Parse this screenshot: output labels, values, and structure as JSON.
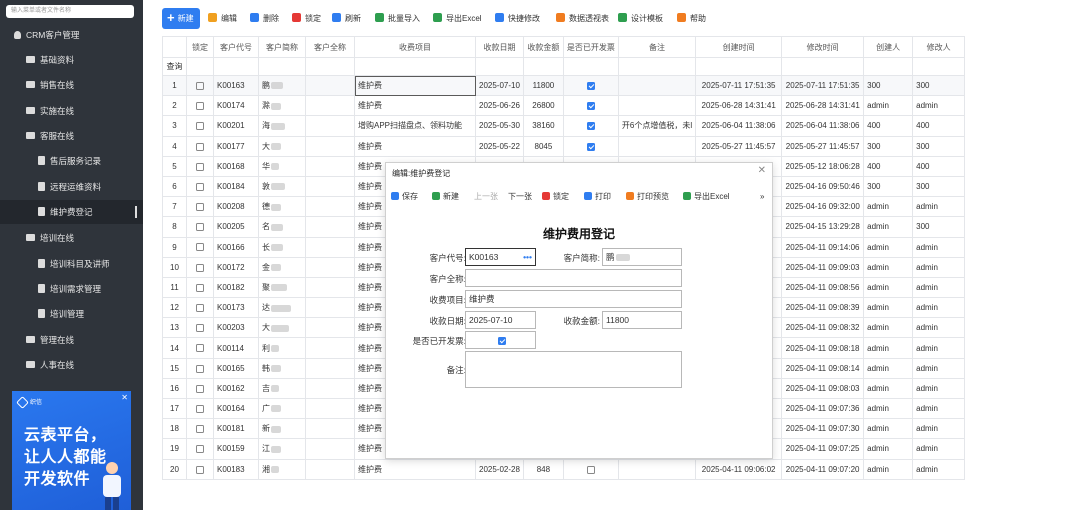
{
  "search": {
    "placeholder": "输入菜单或者文件名称"
  },
  "sidebar": {
    "items": [
      {
        "label": "CRM客户管理",
        "level": 0,
        "icon": "user-icon"
      },
      {
        "label": "基础资料",
        "level": 1,
        "icon": "folder-icon"
      },
      {
        "label": "销售在线",
        "level": 1,
        "icon": "folder-icon"
      },
      {
        "label": "实施在线",
        "level": 1,
        "icon": "folder-icon"
      },
      {
        "label": "客服在线",
        "level": 1,
        "icon": "folder-icon"
      },
      {
        "label": "售后服务记录",
        "level": 2,
        "icon": "doc-icon"
      },
      {
        "label": "远程运维资料",
        "level": 2,
        "icon": "doc-icon"
      },
      {
        "label": "维护费登记",
        "level": 2,
        "icon": "doc-icon",
        "active": true
      },
      {
        "label": "培训在线",
        "level": 1,
        "icon": "folder-icon"
      },
      {
        "label": "培训科目及讲师",
        "level": 2,
        "icon": "doc-icon"
      },
      {
        "label": "培训需求管理",
        "level": 2,
        "icon": "doc-icon"
      },
      {
        "label": "培训管理",
        "level": 2,
        "icon": "doc-icon"
      },
      {
        "label": "管理在线",
        "level": 1,
        "icon": "folder-icon"
      },
      {
        "label": "人事在线",
        "level": 1,
        "icon": "folder-icon"
      }
    ]
  },
  "ad": {
    "brand": "织信",
    "line1": "云表平台，",
    "line2": "让人人都能",
    "line3": "开发软件",
    "close": "✕"
  },
  "toolbar": [
    {
      "label": "新建",
      "icon": "plus-icon",
      "color": "#2f7df0"
    },
    {
      "label": "编辑",
      "icon": "folder-open-icon",
      "color": "#f0a020"
    },
    {
      "label": "删除",
      "icon": "delete-icon",
      "color": "#2f7df0"
    },
    {
      "label": "锁定",
      "icon": "lock-icon",
      "color": "#e53935"
    },
    {
      "label": "刷新",
      "icon": "refresh-icon",
      "color": "#2f7df0"
    },
    {
      "label": "批量导入",
      "icon": "import-icon",
      "color": "#2e9e4f"
    },
    {
      "label": "导出Excel",
      "icon": "excel-icon",
      "color": "#2e9e4f"
    },
    {
      "label": "快捷修改",
      "icon": "edit-icon",
      "color": "#2f7df0"
    },
    {
      "label": "数据透视表",
      "icon": "pivot-icon",
      "color": "#f07c20"
    },
    {
      "label": "设计模板",
      "icon": "template-icon",
      "color": "#2e9e4f"
    },
    {
      "label": "帮助",
      "icon": "help-icon",
      "color": "#f07c20"
    }
  ],
  "grid": {
    "columns": [
      "",
      "锁定",
      "客户代号",
      "客户简称",
      "客户全称",
      "收费项目",
      "收款日期",
      "收款金额",
      "是否已开发票",
      "备注",
      "创建时间",
      "修改时间",
      "创建人",
      "修改人"
    ],
    "query_label": "查询",
    "rows": [
      {
        "n": "1",
        "code": "K00163",
        "short": "鹏",
        "item": "维护费",
        "date": "2025-07-10",
        "amount": "11800",
        "invoice": true,
        "note": "",
        "created": "2025-07-11 17:51:35",
        "modified": "2025-07-11 17:51:35",
        "creator": "300",
        "modifier": "300"
      },
      {
        "n": "2",
        "code": "K00174",
        "short": "滁",
        "item": "维护费",
        "date": "2025-06-26",
        "amount": "26800",
        "invoice": true,
        "note": "",
        "created": "2025-06-28 14:31:41",
        "modified": "2025-06-28 14:31:41",
        "creator": "admin",
        "modifier": "admin"
      },
      {
        "n": "3",
        "code": "K00201",
        "short": "海",
        "item": "增购APP扫描盘点、领料功能",
        "date": "2025-05-30",
        "amount": "38160",
        "invoice": true,
        "note": "开6个点增值税，未l",
        "created": "2025-06-04 11:38:06",
        "modified": "2025-06-04 11:38:06",
        "creator": "400",
        "modifier": "400"
      },
      {
        "n": "4",
        "code": "K00177",
        "short": "大",
        "item": "维护费",
        "date": "2025-05-22",
        "amount": "8045",
        "invoice": true,
        "note": "",
        "created": "2025-05-27 11:45:57",
        "modified": "2025-05-27 11:45:57",
        "creator": "300",
        "modifier": "300"
      },
      {
        "n": "5",
        "code": "K00168",
        "short": "华",
        "item": "维护费",
        "date": "",
        "amount": "",
        "invoice": null,
        "note": "",
        "created": "",
        "modified": "2025-05-12 18:06:28",
        "creator": "400",
        "modifier": "400"
      },
      {
        "n": "6",
        "code": "K00184",
        "short": "敦",
        "item": "维护费",
        "date": "",
        "amount": "",
        "invoice": null,
        "note": "",
        "created": "",
        "modified": "2025-04-16 09:50:46",
        "creator": "300",
        "modifier": "300"
      },
      {
        "n": "7",
        "code": "K00208",
        "short": "德",
        "item": "维护费",
        "date": "",
        "amount": "",
        "invoice": null,
        "note": "",
        "created": "",
        "modified": "2025-04-16 09:32:00",
        "creator": "admin",
        "modifier": "admin"
      },
      {
        "n": "8",
        "code": "K00205",
        "short": "名",
        "item": "维护费",
        "date": "",
        "amount": "",
        "invoice": null,
        "note": "",
        "created": "",
        "modified": "2025-04-15 13:29:28",
        "creator": "admin",
        "modifier": "300"
      },
      {
        "n": "9",
        "code": "K00166",
        "short": "长",
        "item": "维护费",
        "date": "",
        "amount": "",
        "invoice": null,
        "note": "",
        "created": "",
        "modified": "2025-04-11 09:14:06",
        "creator": "admin",
        "modifier": "admin"
      },
      {
        "n": "10",
        "code": "K00172",
        "short": "金",
        "item": "维护费",
        "date": "",
        "amount": "",
        "invoice": null,
        "note": "",
        "created": "",
        "modified": "2025-04-11 09:09:03",
        "creator": "admin",
        "modifier": "admin"
      },
      {
        "n": "11",
        "code": "K00182",
        "short": "聚",
        "item": "维护费",
        "date": "",
        "amount": "",
        "invoice": null,
        "note": "",
        "created": "",
        "modified": "2025-04-11 09:08:56",
        "creator": "admin",
        "modifier": "admin"
      },
      {
        "n": "12",
        "code": "K00173",
        "short": "达",
        "item": "维护费",
        "date": "",
        "amount": "",
        "invoice": null,
        "note": "",
        "created": "",
        "modified": "2025-04-11 09:08:39",
        "creator": "admin",
        "modifier": "admin"
      },
      {
        "n": "13",
        "code": "K00203",
        "short": "大",
        "item": "维护费",
        "date": "",
        "amount": "",
        "invoice": null,
        "note": "",
        "created": "",
        "modified": "2025-04-11 09:08:32",
        "creator": "admin",
        "modifier": "admin"
      },
      {
        "n": "14",
        "code": "K00114",
        "short": "利",
        "item": "维护费",
        "date": "",
        "amount": "",
        "invoice": null,
        "note": "",
        "created": "",
        "modified": "2025-04-11 09:08:18",
        "creator": "admin",
        "modifier": "admin"
      },
      {
        "n": "15",
        "code": "K00165",
        "short": "韩",
        "item": "维护费",
        "date": "",
        "amount": "",
        "invoice": null,
        "note": "",
        "created": "",
        "modified": "2025-04-11 09:08:14",
        "creator": "admin",
        "modifier": "admin"
      },
      {
        "n": "16",
        "code": "K00162",
        "short": "吉",
        "item": "维护费",
        "date": "",
        "amount": "",
        "invoice": null,
        "note": "",
        "created": "",
        "modified": "2025-04-11 09:08:03",
        "creator": "admin",
        "modifier": "admin"
      },
      {
        "n": "17",
        "code": "K00164",
        "short": "广",
        "item": "维护费",
        "date": "",
        "amount": "",
        "invoice": null,
        "note": "",
        "created": "",
        "modified": "2025-04-11 09:07:36",
        "creator": "admin",
        "modifier": "admin"
      },
      {
        "n": "18",
        "code": "K00181",
        "short": "新",
        "item": "维护费",
        "date": "",
        "amount": "",
        "invoice": null,
        "note": "",
        "created": "",
        "modified": "2025-04-11 09:07:30",
        "creator": "admin",
        "modifier": "admin"
      },
      {
        "n": "19",
        "code": "K00159",
        "short": "江",
        "item": "维护费",
        "date": "",
        "amount": "",
        "invoice": null,
        "note": "",
        "created": "",
        "modified": "2025-04-11 09:07:25",
        "creator": "admin",
        "modifier": "admin"
      },
      {
        "n": "20",
        "code": "K00183",
        "short": "湘",
        "item": "维护费",
        "date": "2025-02-28",
        "amount": "848",
        "invoice": false,
        "note": "",
        "created": "2025-04-11 09:06:02",
        "modified": "2025-04-11 09:07:20",
        "creator": "admin",
        "modifier": "admin"
      }
    ]
  },
  "dialog": {
    "title": "编辑:维护费登记",
    "close": "✕",
    "toolbar": [
      {
        "label": "保存",
        "icon": "save-icon",
        "color": "#2f7df0",
        "enabled": true
      },
      {
        "label": "新建",
        "icon": "new-icon",
        "color": "#2e9e4f",
        "enabled": true
      },
      {
        "label": "上一张",
        "icon": "",
        "color": "",
        "enabled": false
      },
      {
        "label": "下一张",
        "icon": "",
        "color": "",
        "enabled": true
      },
      {
        "label": "锁定",
        "icon": "lock-icon",
        "color": "#e53935",
        "enabled": true
      },
      {
        "label": "打印",
        "icon": "print-icon",
        "color": "#2f7df0",
        "enabled": true
      },
      {
        "label": "打印预览",
        "icon": "print-preview-icon",
        "color": "#f07c20",
        "enabled": true
      },
      {
        "label": "导出Excel",
        "icon": "excel-icon",
        "color": "#2e9e4f",
        "enabled": true
      },
      {
        "label": "»",
        "icon": "",
        "color": "",
        "enabled": true
      }
    ],
    "form_title": "维护费用登记",
    "labels": {
      "code": "客户代号:",
      "short": "客户简称:",
      "full": "客户全称:",
      "item": "收费项目:",
      "date": "收款日期:",
      "amount": "收款金额:",
      "invoice": "是否已开发票:",
      "note": "备注:"
    },
    "values": {
      "code": "K00163",
      "code_btn": "•••",
      "short": "鹏",
      "full": "",
      "item": "维护费",
      "date": "2025-07-10",
      "amount": "11800",
      "invoice": true,
      "note": ""
    }
  }
}
